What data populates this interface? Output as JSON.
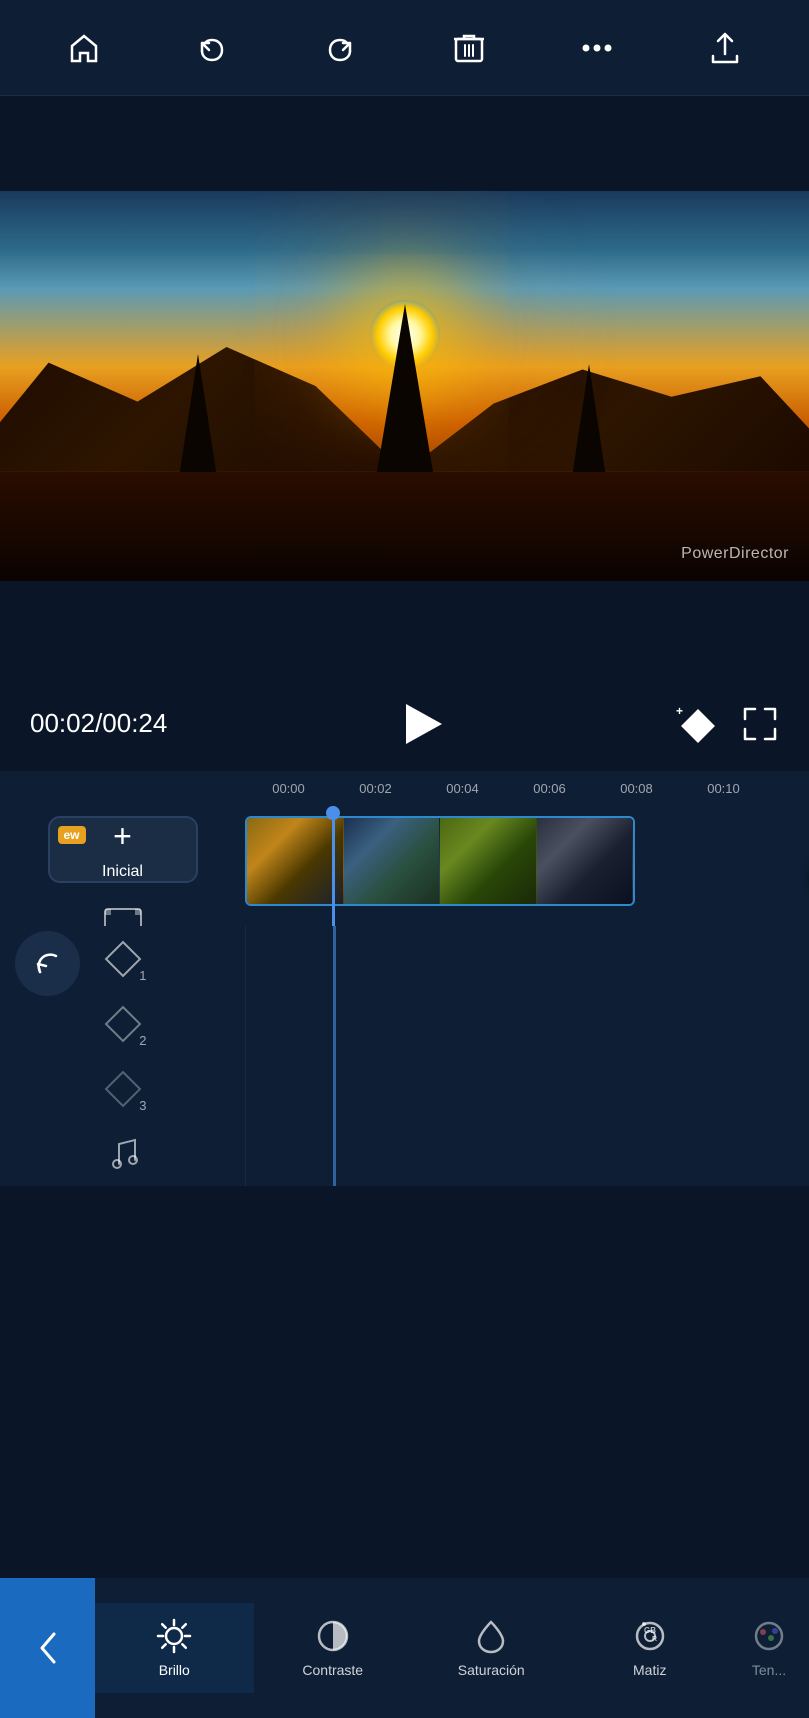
{
  "toolbar": {
    "home_label": "Home",
    "undo_label": "Undo",
    "redo_label": "Redo",
    "delete_label": "Delete",
    "more_label": "More",
    "export_label": "Export"
  },
  "video": {
    "watermark": "PowerDirector"
  },
  "playback": {
    "current_time": "00:02",
    "total_time": "00:24",
    "time_display": "00:02/00:24"
  },
  "timeline": {
    "ruler_marks": [
      "00:00",
      "00:02",
      "00:04",
      "00:06",
      "00:08",
      "00:10"
    ],
    "add_btn_label": "Inicial",
    "add_btn_plus": "+"
  },
  "layers": [
    {
      "num": "1",
      "label": "Layer 1"
    },
    {
      "num": "2",
      "label": "Layer 2"
    },
    {
      "num": "3",
      "label": "Layer 3"
    }
  ],
  "bottom_nav": {
    "back_icon": "‹",
    "items": [
      {
        "id": "brillo",
        "label": "Brillo",
        "active": true
      },
      {
        "id": "contraste",
        "label": "Contraste",
        "active": false
      },
      {
        "id": "saturacion",
        "label": "Saturación",
        "active": false
      },
      {
        "id": "matiz",
        "label": "Matiz",
        "active": false
      },
      {
        "id": "ten",
        "label": "Ten...",
        "active": false
      }
    ]
  }
}
